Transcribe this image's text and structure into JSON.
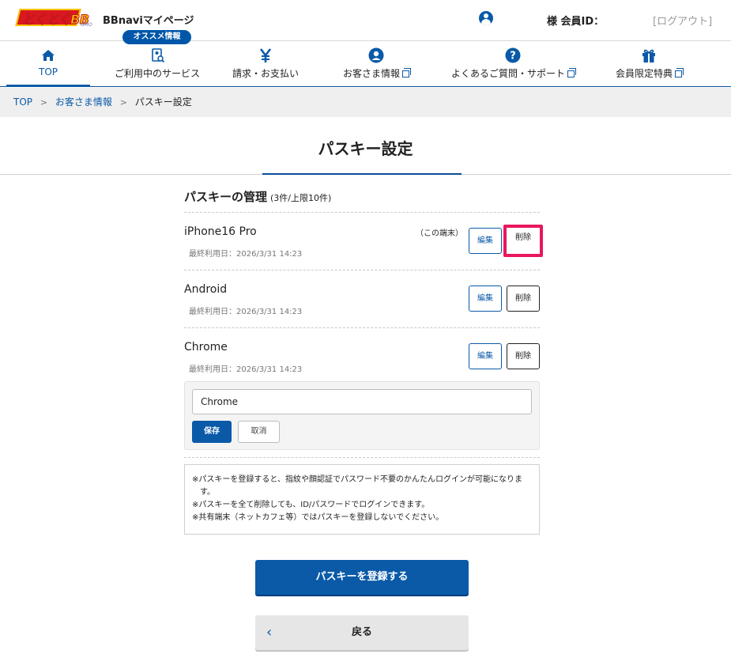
{
  "header": {
    "logo_text": "とくとくBB",
    "logo_sub": "GMO",
    "app_title": "BBnaviマイページ",
    "recommend_badge": "オススメ情報",
    "member_label": "様  会員ID：",
    "logout": "[ログアウト]"
  },
  "nav": {
    "items": [
      {
        "label": "TOP",
        "icon": "home-icon",
        "active": true
      },
      {
        "label": "ご利用中のサービス",
        "icon": "service-search-icon"
      },
      {
        "label": "請求・お支払い",
        "icon": "yen-icon"
      },
      {
        "label": "お客さま情報",
        "icon": "user-icon",
        "external": true
      },
      {
        "label": "よくあるご質問・サポート",
        "icon": "question-icon",
        "external": true
      },
      {
        "label": "会員限定特典",
        "icon": "gift-icon",
        "external": true
      }
    ]
  },
  "breadcrumb": {
    "top": "TOP",
    "customer": "お客さま情報",
    "current": "パスキー設定",
    "separator": ">"
  },
  "page": {
    "title": "パスキー設定",
    "section_title": "パスキーの管理",
    "section_count": "(3件/上限10件)"
  },
  "passkeys": [
    {
      "name": "iPhone16 Pro",
      "last_used": "最終利用日：2026/3/31 14:23",
      "this_device": "（この端末）"
    },
    {
      "name": "Android",
      "last_used": "最終利用日：2026/3/31 14:23"
    },
    {
      "name": "Chrome",
      "last_used": "最終利用日：2026/3/31 14:23"
    }
  ],
  "buttons": {
    "edit": "編集",
    "delete": "削除",
    "save": "保存",
    "cancel": "取消",
    "register": "パスキーを登録する",
    "back": "戻る"
  },
  "edit_form": {
    "value": "Chrome"
  },
  "notes": [
    "※パスキーを登録すると、指紋や顔認証でパスワード不要のかんたんログインが可能になります。",
    "※パスキーを全て削除しても、ID/パスワードでログインできます。",
    "※共有端末（ネットカフェ等）ではパスキーを登録しないでください。"
  ],
  "colors": {
    "primary": "#0a5aa8",
    "highlight": "#e8175d",
    "logo_red": "#d9181f",
    "logo_yellow": "#f5c400"
  }
}
